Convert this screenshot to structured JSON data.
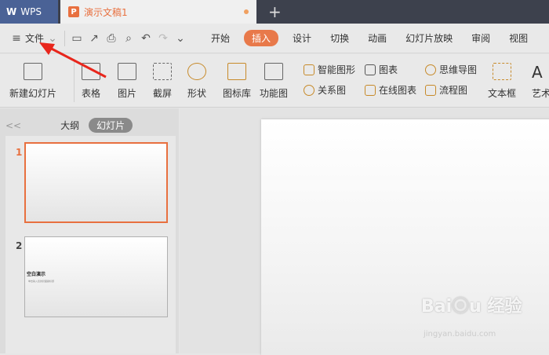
{
  "titlebar": {
    "app": "WPS",
    "doc_title": "演示文稿1",
    "new_tab": "+"
  },
  "menu": {
    "file": "文件",
    "tabs": [
      "开始",
      "插入",
      "设计",
      "切换",
      "动画",
      "幻灯片放映",
      "审阅",
      "视图"
    ],
    "active_tab": "插入"
  },
  "ribbon": {
    "new_slide": "新建幻灯片",
    "table": "表格",
    "picture": "图片",
    "screenshot": "截屏",
    "shape": "形状",
    "icon_lib": "图标库",
    "function_chart": "功能图",
    "smart_art": "智能图形",
    "chart": "图表",
    "relation": "关系图",
    "online_chart": "在线图表",
    "mind_map": "思维导图",
    "flow_chart": "流程图",
    "text_box": "文本框",
    "art_text": "艺术"
  },
  "panel": {
    "collapse": "<<",
    "outline_tab": "大纲",
    "slides_tab": "幻灯片",
    "slides": [
      {
        "num": "1"
      },
      {
        "num": "2",
        "title": "空白演示",
        "subtitle": "单击输入您的封面副标题"
      }
    ]
  },
  "watermark": {
    "logo": "Baidu经验",
    "url": "jingyan.baidu.com"
  },
  "colors": {
    "accent": "#e8794a",
    "wps_blue": "#4a6296",
    "titlebar": "#3d414d"
  }
}
